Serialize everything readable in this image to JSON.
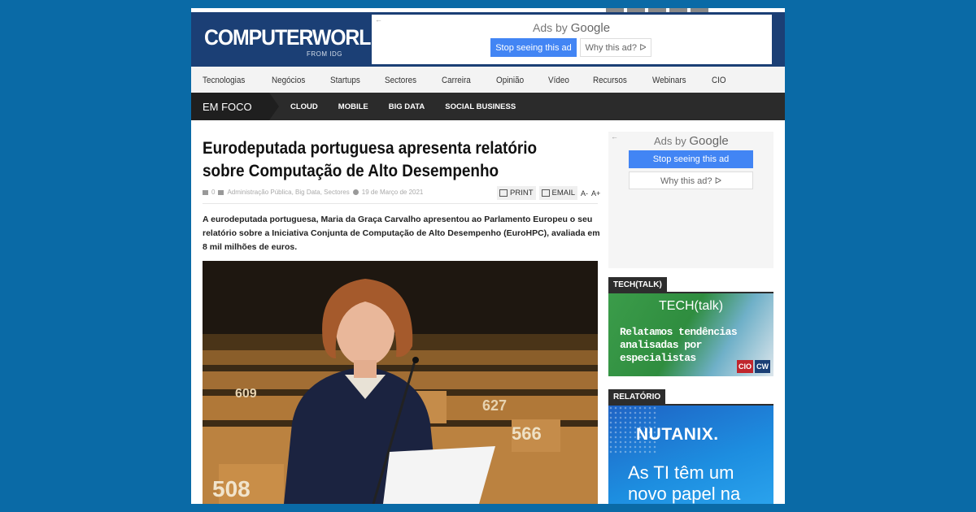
{
  "header": {
    "logo": "COMPUTERWORLD",
    "logo_sub": "FROM IDG"
  },
  "ad_top": {
    "back_icon": "←",
    "ads_by": "Ads by",
    "brand": "Google",
    "stop_label": "Stop seeing this ad",
    "why_label": "Why this ad? ᐅ"
  },
  "nav": {
    "items": [
      "Tecnologias",
      "Negócios",
      "Startups",
      "Sectores",
      "Carreira",
      "Opinião",
      "Vídeo",
      "Recursos",
      "Webinars",
      "CIO"
    ]
  },
  "focus": {
    "label": "EM FOCO",
    "items": [
      "CLOUD",
      "MOBILE",
      "BIG DATA",
      "SOCIAL BUSINESS"
    ]
  },
  "article": {
    "title": "Eurodeputada portuguesa apresenta relatório sobre Computação de Alto Desempenho",
    "comments": "0",
    "categories": "Administração Pública, Big Data, Sectores",
    "date": "19 de Março de 2021",
    "print_label": "PRINT",
    "email_label": "EMAIL",
    "font_smaller": "A-",
    "font_larger": "A+",
    "lead": "A eurodeputada portuguesa, Maria da Graça Carvalho apresentou ao Parlamento Europeu o seu relatório sobre a Iniciativa Conjunta de Computação de Alto Desempenho (EuroHPC), avaliada em 8 mil milhões de euros.",
    "photo_numbers": [
      "609",
      "627",
      "566",
      "508"
    ]
  },
  "ad_side": {
    "back_icon": "←",
    "ads_by": "Ads by",
    "brand": "Google",
    "stop_label": "Stop seeing this ad",
    "why_label": "Why this ad? ᐅ"
  },
  "sidebar": {
    "techtalk_label": "TECH(TALK)",
    "techtalk_title": "TECH(talk)",
    "techtalk_text": "Relatamos tendências analisadas por especialistas",
    "logo_cio": "CIO",
    "logo_cw": "CW",
    "relatorio_label": "RELATÓRIO",
    "nutanix_logo": "NUTANIX.",
    "nutanix_text": "As TI têm um novo papel na"
  },
  "colors": {
    "background": "#0a6aa6",
    "header": "#1b3f75",
    "ad_button": "#4285f4",
    "focus_bar": "#2b2b2b"
  }
}
